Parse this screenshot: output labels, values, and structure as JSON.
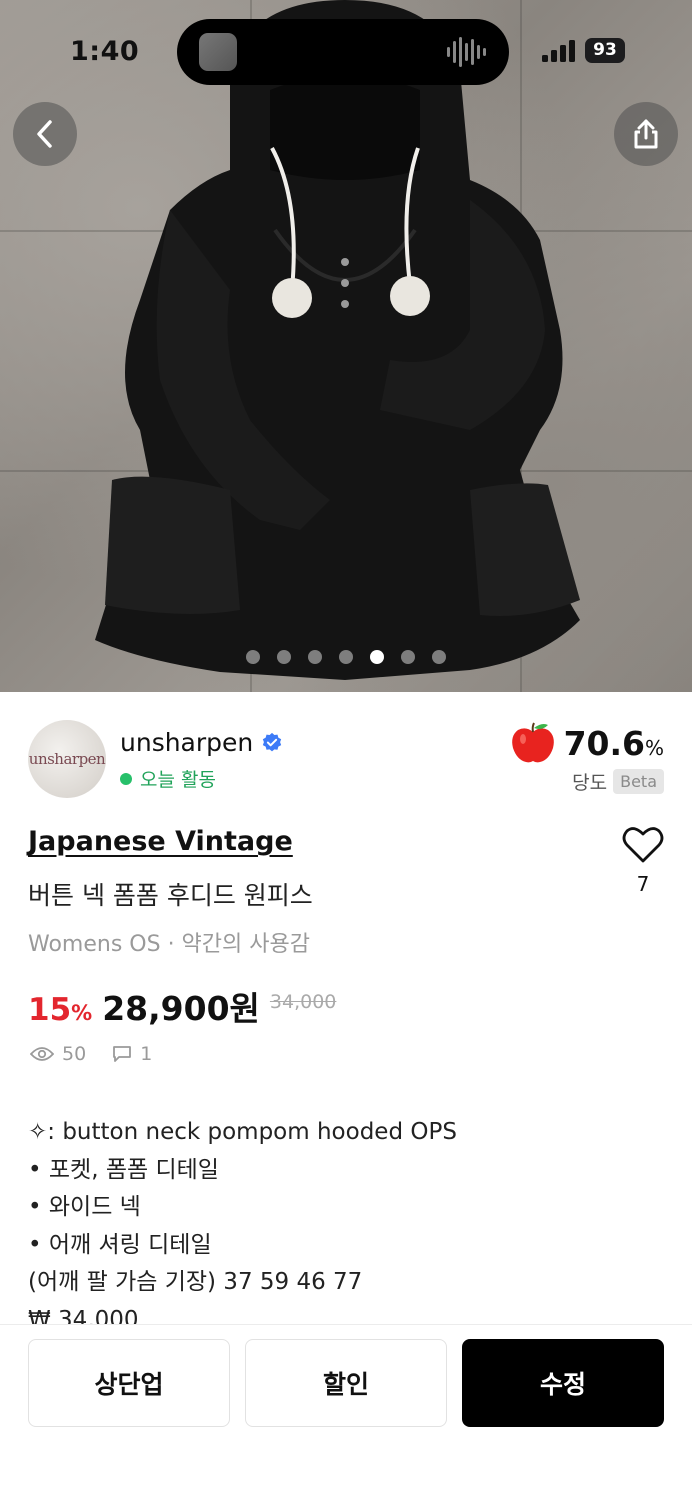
{
  "status_bar": {
    "time": "1:40",
    "battery": "93"
  },
  "gallery": {
    "image_count": 7,
    "active_index": 4
  },
  "seller": {
    "avatar_text": "unsharpen",
    "name": "unsharpen",
    "activity": "오늘 활동",
    "sweetness_value": "70.6",
    "sweetness_unit": "%",
    "sweetness_label": "당도",
    "beta_badge": "Beta"
  },
  "product": {
    "brand": "Japanese Vintage",
    "title": "버튼 넥 폼폼 후디드 원피스",
    "meta": "Womens OS · 약간의 사용감",
    "like_count": "7",
    "discount_value": "15",
    "discount_unit": "%",
    "price": "28,900원",
    "original_price": "34,000",
    "views": "50",
    "comments": "1"
  },
  "description": [
    "✧: button neck pompom hooded OPS",
    "• 포켓, 폼폼 디테일",
    "• 와이드 넥",
    "• 어깨 셔링 디테일",
    "(어깨 팔 가슴 기장) 37 59 46 77",
    "₩ 34,000"
  ],
  "actions": {
    "bump": "상단업",
    "discount": "할인",
    "edit": "수정"
  },
  "colors": {
    "discount_red": "#e3262e",
    "active_green": "#21a35a",
    "verified_blue": "#3d7bf7"
  }
}
